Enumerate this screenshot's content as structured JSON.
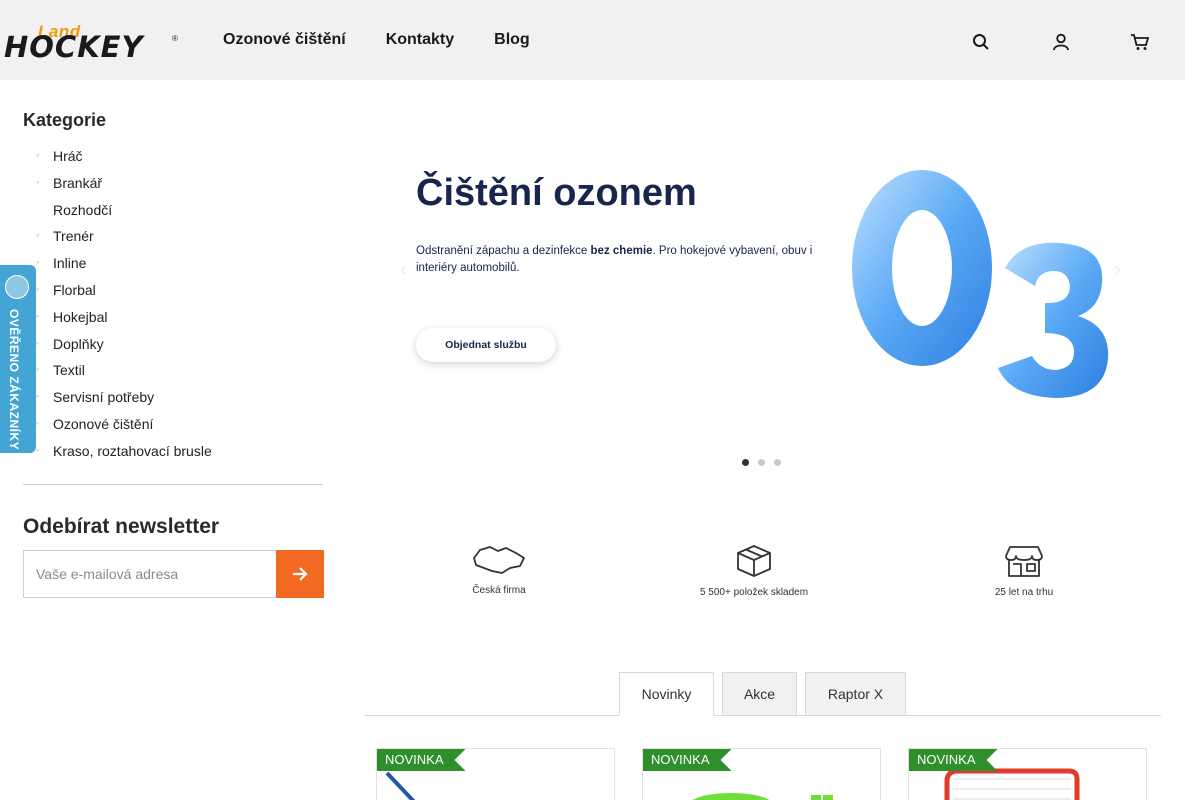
{
  "header": {
    "logo_land": "Land",
    "logo_hockey": "HOCKEY",
    "logo_reg": "®",
    "nav": [
      "Ozonové čištění",
      "Kontakty",
      "Blog"
    ],
    "icons": [
      "search-icon",
      "user-icon",
      "cart-icon"
    ]
  },
  "sidebar": {
    "title": "Kategorie",
    "items": [
      {
        "label": "Hráč",
        "bullet": true
      },
      {
        "label": "Brankář",
        "bullet": true
      },
      {
        "label": "Rozhodčí",
        "bullet": false
      },
      {
        "label": "Trenér",
        "bullet": true
      },
      {
        "label": "Inline",
        "bullet": true
      },
      {
        "label": "Florbal",
        "bullet": true
      },
      {
        "label": "Hokejbal",
        "bullet": true
      },
      {
        "label": "Doplňky",
        "bullet": true
      },
      {
        "label": "Textil",
        "bullet": true
      },
      {
        "label": "Servisní potřeby",
        "bullet": true
      },
      {
        "label": "Ozonové čištění",
        "bullet": true
      },
      {
        "label": "Kraso, roztahovací brusle",
        "bullet": true
      }
    ],
    "bullet_char": "◦"
  },
  "newsletter": {
    "title": "Odebírat newsletter",
    "placeholder": "Vaše e-mailová adresa"
  },
  "badge": {
    "text": "OVĚŘENO ZÁKAZNÍKY",
    "color": "#44a5d4"
  },
  "banner": {
    "title": "Čištění ozonem",
    "text_before": "Odstranění zápachu a dezinfekce ",
    "text_bold": "bez chemie",
    "text_after": ". Pro hokejové vybavení, obuv i interiéry automobilů.",
    "button": "Objednat službu",
    "big_0": "0",
    "big_3": "3",
    "prev": "‹",
    "next": "›",
    "slides": 3,
    "active_slide": 1
  },
  "features": [
    {
      "label": "Česká firma",
      "icon": "czech-map-icon"
    },
    {
      "label": "5 500+ položek skladem",
      "icon": "box-icon"
    },
    {
      "label": "25 let na trhu",
      "icon": "store-icon"
    }
  ],
  "tabs": [
    {
      "label": "Novinky",
      "active": true
    },
    {
      "label": "Akce",
      "active": false
    },
    {
      "label": "Raptor X",
      "active": false
    }
  ],
  "products": [
    {
      "ribbon": "NOVINKA",
      "image": "hockey-stick-image"
    },
    {
      "ribbon": "NOVINKA",
      "image": "green-puck-image"
    },
    {
      "ribbon": "NOVINKA",
      "image": "hockey-goal-image"
    }
  ],
  "colors": {
    "accent": "#f26a21",
    "ribbon": "#2f8f2a",
    "banner_text": "#17264d",
    "logo_orange": "#f29a12"
  }
}
